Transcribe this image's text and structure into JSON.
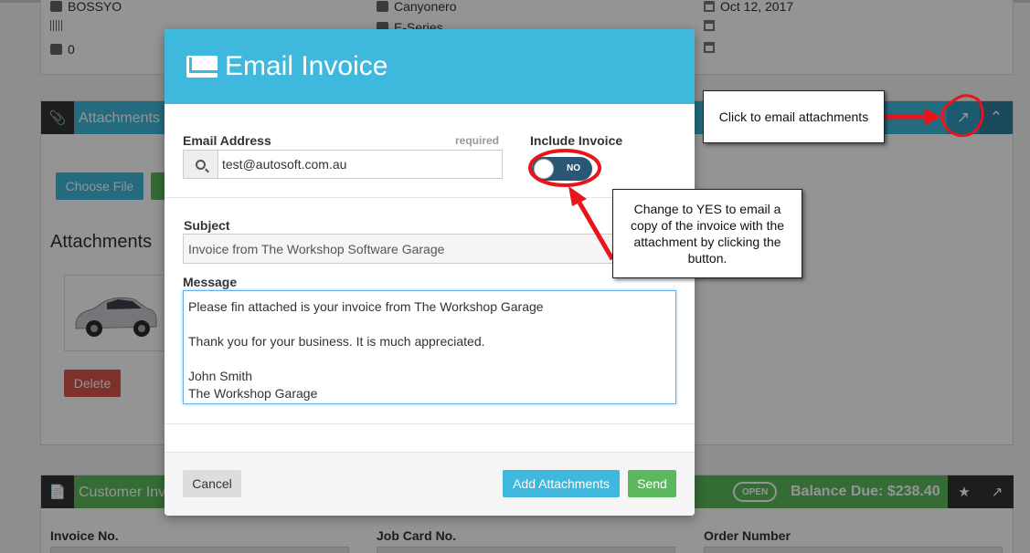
{
  "background": {
    "vehicle_info": {
      "col1": [
        "BOSSYO",
        "",
        "0"
      ],
      "col2": [
        "Canyonero",
        "E-Series",
        ""
      ],
      "col3": [
        "Oct 12, 2017",
        "",
        ""
      ]
    },
    "attachments_panel": {
      "title": "Attachments",
      "choose_file": "Choose File",
      "upload": "U",
      "section_title": "Attachments",
      "delete": "Delete"
    },
    "invoice_panel": {
      "title": "Customer Inv",
      "status_badge": "OPEN",
      "balance": "Balance Due: $238.40",
      "fields": [
        "Invoice No.",
        "Job Card No.",
        "Order Number"
      ]
    }
  },
  "modal": {
    "title": "Email Invoice",
    "email_label": "Email Address",
    "required_text": "required",
    "email_value": "test@autosoft.com.au",
    "include_invoice_label": "Include Invoice",
    "toggle_text": "NO",
    "subject_label": "Subject",
    "subject_value": "Invoice from The Workshop Software Garage",
    "message_label": "Message",
    "message_lines": [
      "Please fin attached is your invoice from The Workshop Garage",
      "",
      "Thank you for your business. It is much appreciated.",
      "",
      "John Smith",
      "The Workshop Garage"
    ],
    "cancel": "Cancel",
    "add_attachments": "Add Attachments",
    "send": "Send"
  },
  "annotations": {
    "callout_email": "Click to email attachments",
    "callout_toggle": "Change to YES to email a copy of the invoice with the attachment by clicking the button."
  },
  "colors": {
    "primary": "#3fb8dd",
    "success": "#5cb85c",
    "danger": "#d9534f",
    "toggle_off": "#2a5775",
    "annotation": "#e8151b"
  }
}
